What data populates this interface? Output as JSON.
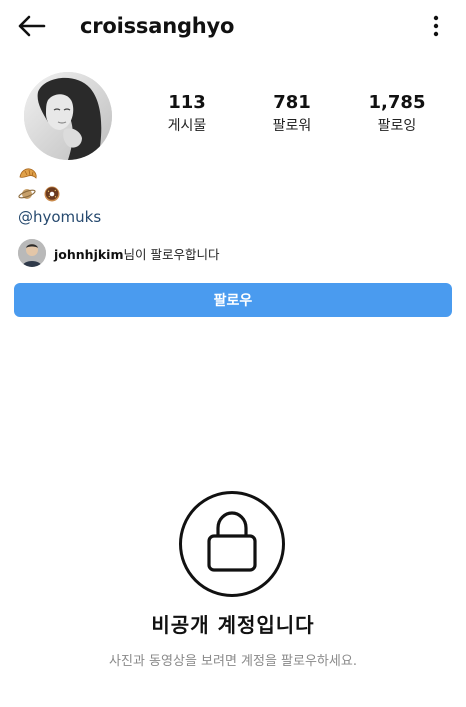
{
  "header": {
    "username": "croissanghyo"
  },
  "stats": {
    "posts_value": "113",
    "posts_label": "게시물",
    "followers_value": "781",
    "followers_label": "팔로워",
    "following_value": "1,785",
    "following_label": "팔로잉"
  },
  "bio": {
    "line1_emoji": "croissant",
    "line2_emoji": [
      "planet",
      "doughnut"
    ],
    "link": "@hyomuks"
  },
  "followed_by": {
    "name": "johnhjkim",
    "suffix": "님이 팔로우합니다"
  },
  "follow_button": {
    "label": "팔로우"
  },
  "private": {
    "title": "비공개 계정입니다",
    "subtitle": "사진과 동영상을 보려면 계정을 팔로우하세요."
  },
  "colors": {
    "button_blue": "#4a9bef",
    "link_blue": "#274a6f",
    "subtitle_gray": "#8a8a8a"
  }
}
